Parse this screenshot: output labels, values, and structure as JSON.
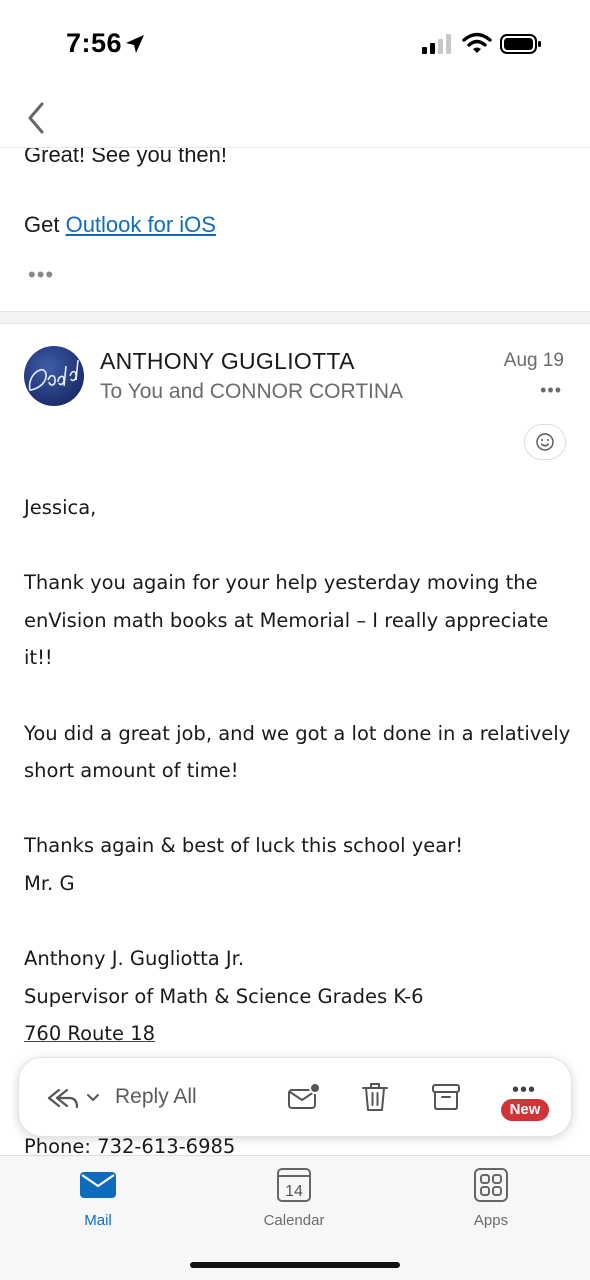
{
  "status_bar": {
    "time": "7:56"
  },
  "previous_message": {
    "line1": "Great! See you then!",
    "get_prefix": "Get ",
    "link_text": "Outlook for iOS",
    "more": "•••"
  },
  "message": {
    "sender": "ANTHONY GUGLIOTTA",
    "recipients": "To You and CONNOR CORTINA",
    "date": "Aug 19",
    "more": "•••",
    "body": {
      "greeting": "Jessica,",
      "p1_l1": "Thank you again for your help yesterday moving the",
      "p1_l2": "enVision math books at Memorial – I really appreciate",
      "p1_l3": "it!!",
      "p2_l1": "You did a great job, and we got a lot done in a relatively",
      "p2_l2": "short amount of time!",
      "p3_l1": "Thanks again & best of luck this school year!",
      "p3_l2": "Mr. G",
      "sig_name": "Anthony J. Gugliotta Jr.",
      "sig_title": "Supervisor of Math & Science Grades K-6",
      "sig_address": "760 Route 18",
      "sig_phone": "Phone: 732-613-6985"
    }
  },
  "action_bar": {
    "reply_all": "Reply All",
    "more": "•••",
    "new_badge": "New"
  },
  "tab_bar": {
    "tabs": [
      {
        "label": "Mail"
      },
      {
        "label": "Calendar",
        "icon_text": "14"
      },
      {
        "label": "Apps"
      }
    ]
  },
  "colors": {
    "accent": "#0f6cbd",
    "badge": "#d13438"
  }
}
